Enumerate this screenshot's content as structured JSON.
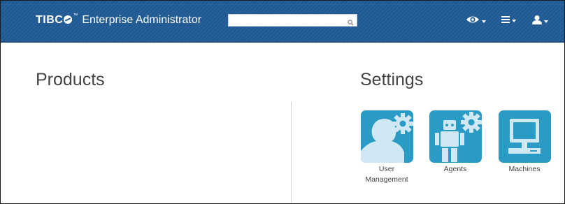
{
  "header": {
    "logo_text": "TIBC",
    "trademark": "™",
    "title": "Enterprise Administrator",
    "search": {
      "value": "",
      "placeholder": ""
    },
    "icons": [
      "eye-icon",
      "menu-icon",
      "user-icon"
    ]
  },
  "products": {
    "title": "Products"
  },
  "settings": {
    "title": "Settings",
    "tiles": [
      {
        "label_line1": "User",
        "label_line2": "Management",
        "icon": "user-gear-icon"
      },
      {
        "label_line1": "Agents",
        "label_line2": "",
        "icon": "robot-gear-icon"
      },
      {
        "label_line1": "Machines",
        "label_line2": "",
        "icon": "computer-icon"
      }
    ]
  },
  "colors": {
    "header_bg": "#215c97",
    "tile_bg": "#2a9bc5",
    "tile_fg": "#cfe8f3"
  }
}
